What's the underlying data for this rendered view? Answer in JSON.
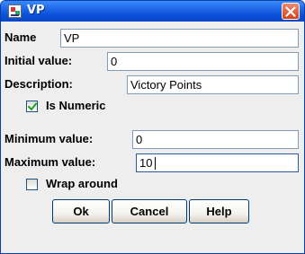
{
  "window": {
    "title": "VP"
  },
  "fields": {
    "name": {
      "label": "Name",
      "value": "VP"
    },
    "initial": {
      "label": "Initial value:",
      "value": "0"
    },
    "description": {
      "label": "Description:",
      "value": "Victory Points"
    },
    "minimum": {
      "label": "Minimum value:",
      "value": "0"
    },
    "maximum": {
      "label": "Maximum value:",
      "value": "10"
    }
  },
  "checkboxes": {
    "is_numeric": {
      "label": "Is Numeric",
      "checked": true
    },
    "wrap_around": {
      "label": "Wrap around",
      "checked": false
    }
  },
  "buttons": {
    "ok": "Ok",
    "cancel": "Cancel",
    "help": "Help"
  },
  "colors": {
    "titlebar": "#0a4fd8",
    "close": "#d34218",
    "field_border": "#7f9db9",
    "dialog_bg": "#eeeeee"
  },
  "icons": {
    "app": "app-icon",
    "close": "close-icon",
    "check": "checkmark-icon"
  }
}
